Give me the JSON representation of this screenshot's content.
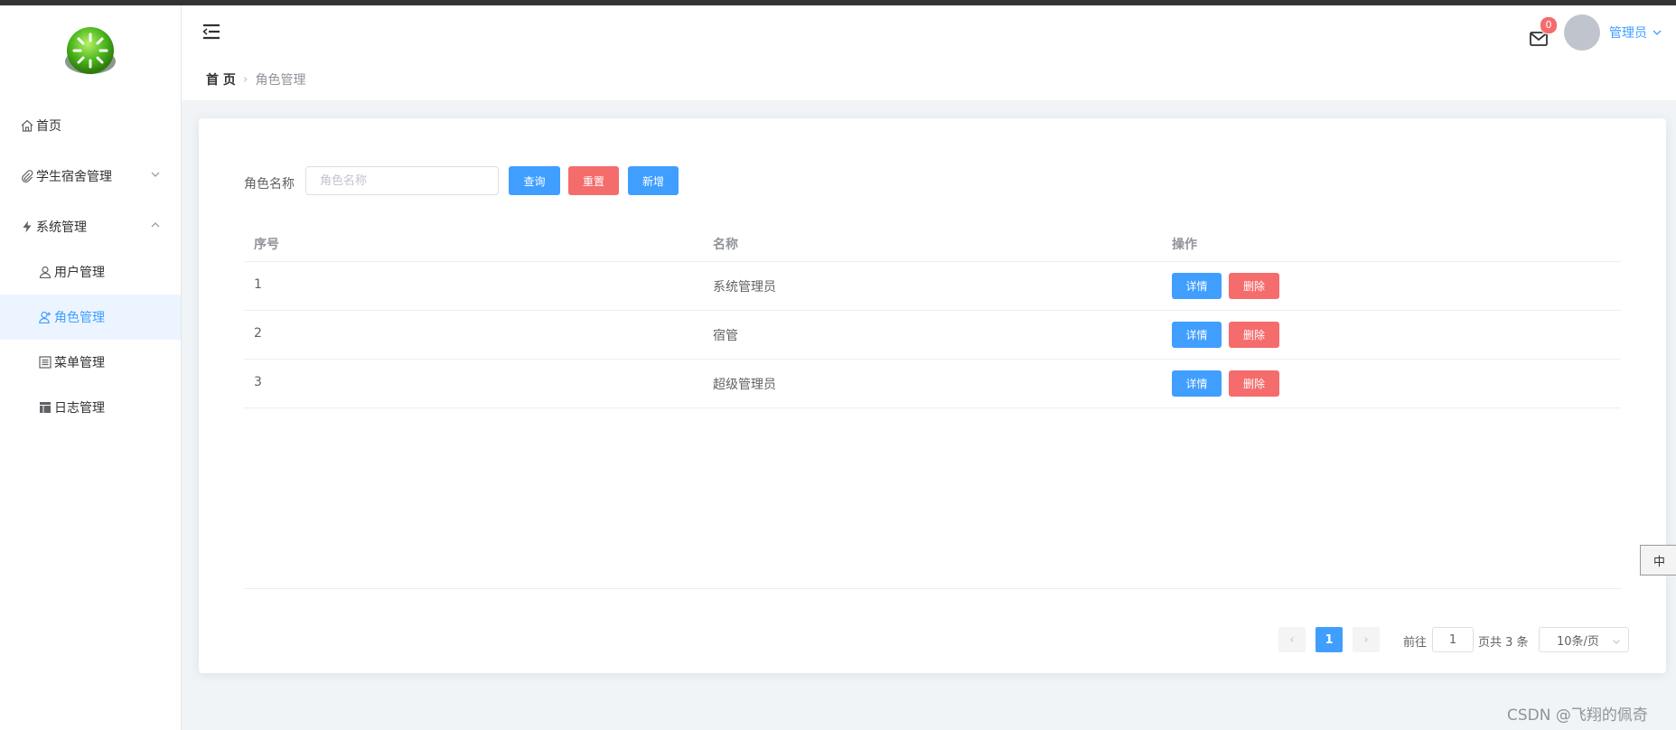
{
  "sidebar": {
    "items": [
      {
        "label": "首页"
      },
      {
        "label": "学生宿舍管理"
      },
      {
        "label": "系统管理"
      },
      {
        "label": "用户管理"
      },
      {
        "label": "角色管理"
      },
      {
        "label": "菜单管理"
      },
      {
        "label": "日志管理"
      }
    ]
  },
  "header": {
    "breadcrumb_home": "首 页",
    "breadcrumb_current": "角色管理",
    "mail_badge": "0",
    "user_name": "管理员"
  },
  "search": {
    "label": "角色名称",
    "placeholder": "角色名称",
    "value": "",
    "query_label": "查询",
    "reset_label": "重置",
    "add_label": "新增"
  },
  "table": {
    "columns": [
      "序号",
      "名称",
      "操作"
    ],
    "rows": [
      {
        "index": "1",
        "name": "系统管理员"
      },
      {
        "index": "2",
        "name": "宿管"
      },
      {
        "index": "3",
        "name": "超级管理员"
      }
    ],
    "detail_label": "详情",
    "delete_label": "删除"
  },
  "pagination": {
    "prev": "‹",
    "current_page": "1",
    "next": "›",
    "goto_label": "前往",
    "goto_value": "1",
    "total_text": "页共 3 条",
    "page_size": "10条/页"
  },
  "ime_tab": "中",
  "watermark": "CSDN @飞翔的佩奇",
  "colors": {
    "primary": "#409eff",
    "danger": "#f56c6c",
    "background": "#f0f4f6"
  }
}
